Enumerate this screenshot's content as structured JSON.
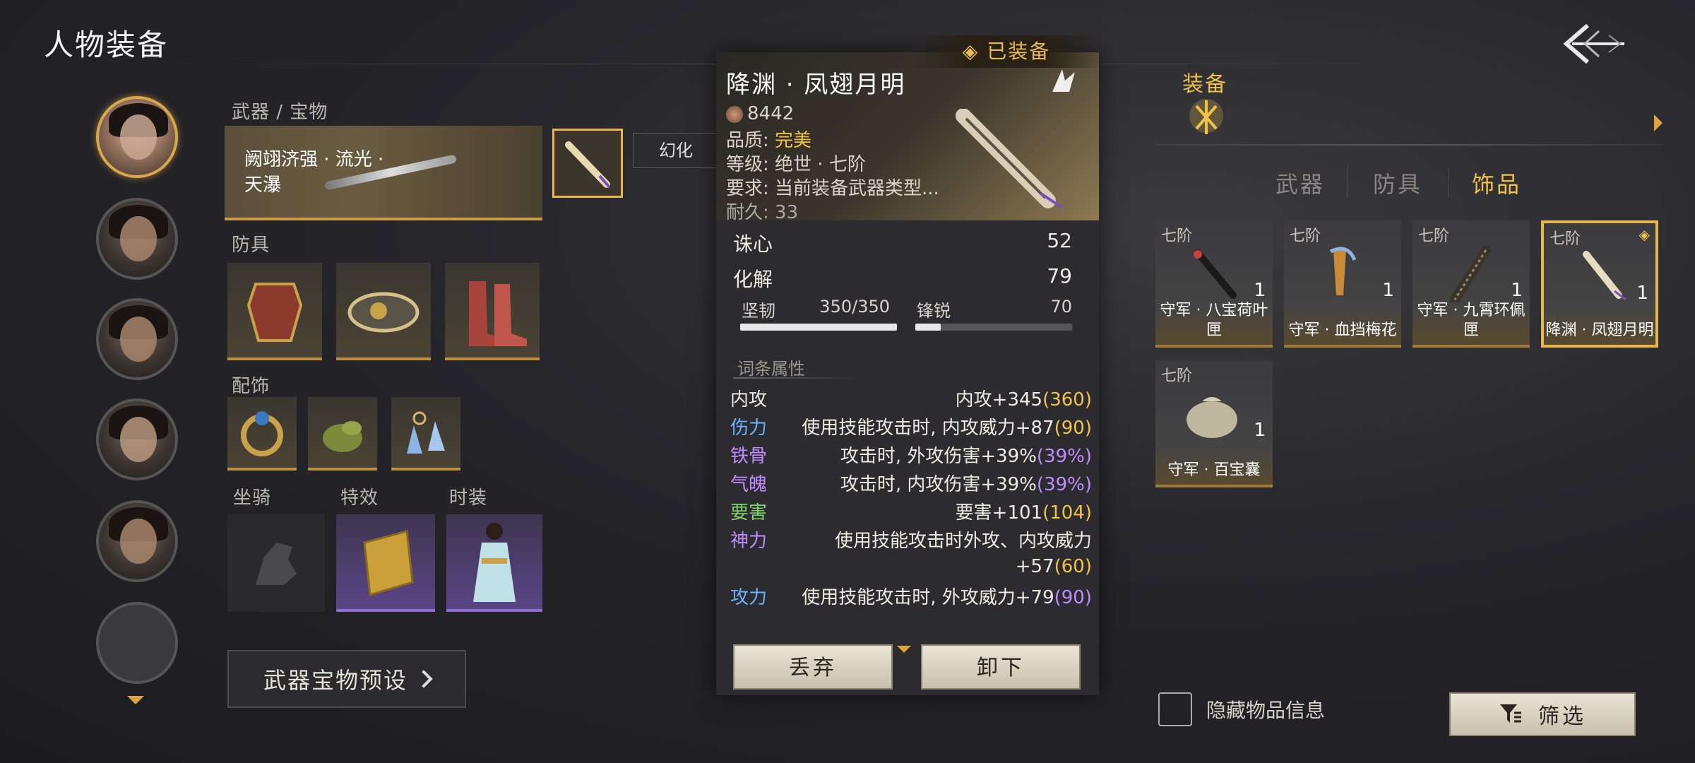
{
  "page": {
    "title": "人物装备"
  },
  "left": {
    "sections": {
      "weapon": "武器 / 宝物",
      "armor": "防具",
      "accessory": "配饰",
      "mount": "坐骑",
      "effect": "特效",
      "fashion": "时装"
    },
    "weapon_name": "阙翊济强 · 流光 · 天瀑",
    "transform_label": "幻化",
    "preset_button": "武器宝物预设"
  },
  "popup": {
    "equipped_tag": "已装备",
    "name": "降渊 · 凤翅月明",
    "power": "8442",
    "quality_label": "品质:",
    "quality_value": "完美",
    "grade": "等级: 绝世 · 七阶",
    "requirement": "要求: 当前装备武器类型...",
    "durability": "耐久: 33",
    "stats": [
      {
        "name": "诛心",
        "value": "52"
      },
      {
        "name": "化解",
        "value": "79"
      }
    ],
    "toughness": {
      "name": "坚韧",
      "value": "350/350",
      "fraction": 1.0
    },
    "sharpness": {
      "name": "锋锐",
      "value": "70",
      "fraction": 0.16
    },
    "affix_header": "词条属性",
    "affixes": [
      {
        "name": "内攻",
        "desc": "内攻+345",
        "paren": "(360)",
        "name_color": "white",
        "paren_color": "gold"
      },
      {
        "name": "伤力",
        "desc": "使用技能攻击时, 内攻威力+87",
        "paren": "(90)",
        "name_color": "blue",
        "paren_color": "gold"
      },
      {
        "name": "铁骨",
        "desc": "攻击时, 外攻伤害+39%",
        "paren": "(39%)",
        "name_color": "purple",
        "paren_color": "purple"
      },
      {
        "name": "气魄",
        "desc": "攻击时, 内攻伤害+39%",
        "paren": "(39%)",
        "name_color": "purple",
        "paren_color": "purple"
      },
      {
        "name": "要害",
        "desc": "要害+101",
        "paren": "(104)",
        "name_color": "green",
        "paren_color": "gold"
      },
      {
        "name": "神力",
        "desc": "使用技能攻击时外攻、内攻威力+57",
        "paren": "(60)",
        "name_color": "purple",
        "paren_color": "gold"
      },
      {
        "name": "攻力",
        "desc": "使用技能攻击时, 外攻威力+79",
        "paren": "(90)",
        "name_color": "blue",
        "paren_color": "purple"
      }
    ],
    "discard_button": "丢弃",
    "unequip_button": "卸下"
  },
  "right": {
    "equip_label": "装备",
    "tabs": [
      "武器",
      "防具",
      "饰品"
    ],
    "active_tab": "饰品",
    "items": [
      {
        "tier": "七阶",
        "count": "1",
        "name": "守军 · 八宝荷叶匣"
      },
      {
        "tier": "七阶",
        "count": "1",
        "name": "守军 · 血挡梅花"
      },
      {
        "tier": "七阶",
        "count": "1",
        "name": "守军 · 九霄环佩匣"
      },
      {
        "tier": "七阶",
        "count": "1",
        "name": "降渊 · 凤翅月明"
      },
      {
        "tier": "七阶",
        "count": "1",
        "name": "守军 · 百宝囊"
      }
    ],
    "hide_info_label": "隐藏物品信息",
    "filter_button": "筛选"
  },
  "colors": {
    "accent_gold": "#f0c348",
    "blue": "#6ab4ff",
    "purple": "#c08cff",
    "green": "#7fd46a"
  }
}
